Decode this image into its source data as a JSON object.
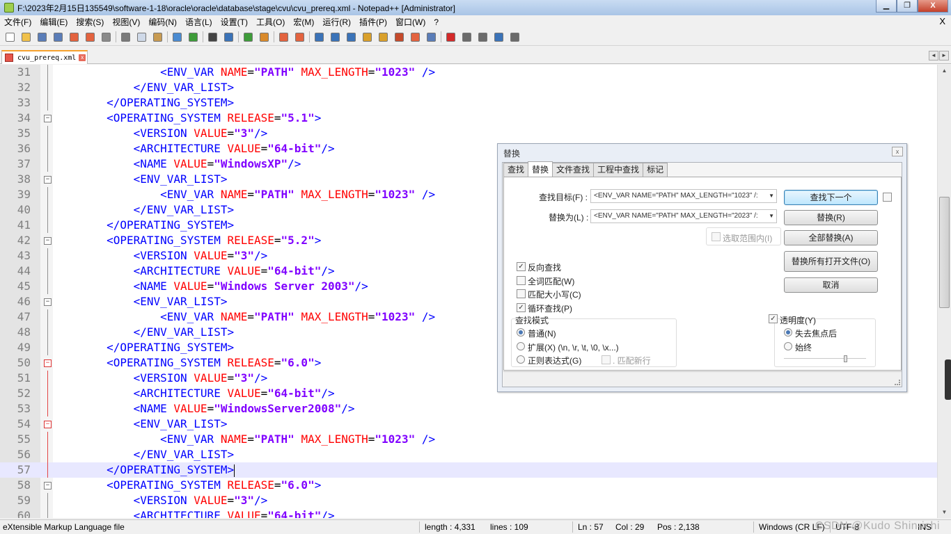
{
  "window": {
    "title": "F:\\2023年2月15日135549\\software-1-18\\oracle\\oracle\\database\\stage\\cvu\\cvu_prereq.xml - Notepad++ [Administrator]",
    "minimize": "▁",
    "maximize": "❐",
    "close": "X"
  },
  "menu": {
    "items": [
      "文件(F)",
      "编辑(E)",
      "搜索(S)",
      "视图(V)",
      "编码(N)",
      "语言(L)",
      "设置(T)",
      "工具(O)",
      "宏(M)",
      "运行(R)",
      "插件(P)",
      "窗口(W)",
      "?"
    ],
    "close": "X"
  },
  "toolbar": {
    "groups": [
      [
        {
          "icon": "new-file-icon",
          "color": "#ffffff"
        },
        {
          "icon": "open-file-icon",
          "color": "#f0c14b"
        },
        {
          "icon": "save-icon",
          "color": "#5a7db8"
        },
        {
          "icon": "save-all-icon",
          "color": "#5a7db8"
        },
        {
          "icon": "close-icon",
          "color": "#e3633f"
        },
        {
          "icon": "close-all-icon",
          "color": "#e3633f"
        },
        {
          "icon": "print-icon",
          "color": "#8a8a8a"
        }
      ],
      [
        {
          "icon": "cut-icon",
          "color": "#7a7a7a"
        },
        {
          "icon": "copy-icon",
          "color": "#cfd9e8"
        },
        {
          "icon": "paste-icon",
          "color": "#c89b52"
        }
      ],
      [
        {
          "icon": "undo-icon",
          "color": "#4b8bd1"
        },
        {
          "icon": "redo-icon",
          "color": "#3e9c3a"
        }
      ],
      [
        {
          "icon": "find-icon",
          "color": "#444444"
        },
        {
          "icon": "replace-icon",
          "color": "#3b73b8"
        }
      ],
      [
        {
          "icon": "zoom-in-icon",
          "color": "#3e9c3a"
        },
        {
          "icon": "zoom-out-icon",
          "color": "#d98a2b"
        }
      ],
      [
        {
          "icon": "sync-vertical-icon",
          "color": "#e3633f"
        },
        {
          "icon": "sync-horizontal-icon",
          "color": "#e3633f"
        }
      ],
      [
        {
          "icon": "word-wrap-icon",
          "color": "#3b73b8"
        },
        {
          "icon": "show-all-chars-icon",
          "color": "#3b73b8"
        },
        {
          "icon": "indent-guide-icon",
          "color": "#3b73b8"
        },
        {
          "icon": "user-lang-icon",
          "color": "#d9a02b"
        },
        {
          "icon": "doc-map-icon",
          "color": "#d9a02b"
        },
        {
          "icon": "function-list-icon",
          "color": "#c54a2b"
        },
        {
          "icon": "folder-workspace-icon",
          "color": "#e3633f"
        },
        {
          "icon": "monitor-icon",
          "color": "#5a7db8"
        }
      ],
      [
        {
          "icon": "record-macro-icon",
          "color": "#d42a2a"
        },
        {
          "icon": "stop-macro-icon",
          "color": "#6b6b6b"
        },
        {
          "icon": "play-macro-icon",
          "color": "#6b6b6b"
        },
        {
          "icon": "run-macro-multiple-icon",
          "color": "#3b73b8"
        },
        {
          "icon": "save-macro-icon",
          "color": "#6b6b6b"
        }
      ]
    ]
  },
  "tabs": {
    "active_label": "cvu_prereq.xml",
    "close": "x",
    "scroll_left": "◄",
    "scroll_right": "►"
  },
  "editor": {
    "lines": [
      {
        "n": "31",
        "fold": "line",
        "tokens": [
          [
            "t",
            "                "
          ],
          [
            "g",
            "<ENV_VAR "
          ],
          [
            "a",
            "NAME"
          ],
          [
            "t",
            "="
          ],
          [
            "v",
            "\"PATH\""
          ],
          [
            "t",
            " "
          ],
          [
            "a",
            "MAX_LENGTH"
          ],
          [
            "t",
            "="
          ],
          [
            "v",
            "\"1023\""
          ],
          [
            "t",
            " "
          ],
          [
            "g",
            "/>"
          ]
        ]
      },
      {
        "n": "32",
        "fold": "line",
        "tokens": [
          [
            "t",
            "            "
          ],
          [
            "g",
            "</ENV_VAR_LIST>"
          ]
        ]
      },
      {
        "n": "33",
        "fold": "line",
        "tokens": [
          [
            "t",
            "        "
          ],
          [
            "g",
            "</OPERATING_SYSTEM>"
          ]
        ]
      },
      {
        "n": "34",
        "fold": "box",
        "tokens": [
          [
            "t",
            "        "
          ],
          [
            "g",
            "<OPERATING_SYSTEM "
          ],
          [
            "a",
            "RELEASE"
          ],
          [
            "t",
            "="
          ],
          [
            "v",
            "\"5.1\""
          ],
          [
            "g",
            ">"
          ]
        ]
      },
      {
        "n": "35",
        "fold": "line",
        "tokens": [
          [
            "t",
            "            "
          ],
          [
            "g",
            "<VERSION "
          ],
          [
            "a",
            "VALUE"
          ],
          [
            "t",
            "="
          ],
          [
            "v",
            "\"3\""
          ],
          [
            "g",
            "/>"
          ]
        ]
      },
      {
        "n": "36",
        "fold": "line",
        "tokens": [
          [
            "t",
            "            "
          ],
          [
            "g",
            "<ARCHITECTURE "
          ],
          [
            "a",
            "VALUE"
          ],
          [
            "t",
            "="
          ],
          [
            "v",
            "\"64-bit\""
          ],
          [
            "g",
            "/>"
          ]
        ]
      },
      {
        "n": "37",
        "fold": "line",
        "tokens": [
          [
            "t",
            "            "
          ],
          [
            "g",
            "<NAME "
          ],
          [
            "a",
            "VALUE"
          ],
          [
            "t",
            "="
          ],
          [
            "v",
            "\"WindowsXP\""
          ],
          [
            "g",
            "/>"
          ]
        ]
      },
      {
        "n": "38",
        "fold": "box",
        "tokens": [
          [
            "t",
            "            "
          ],
          [
            "g",
            "<ENV_VAR_LIST>"
          ]
        ]
      },
      {
        "n": "39",
        "fold": "line",
        "tokens": [
          [
            "t",
            "                "
          ],
          [
            "g",
            "<ENV_VAR "
          ],
          [
            "a",
            "NAME"
          ],
          [
            "t",
            "="
          ],
          [
            "v",
            "\"PATH\""
          ],
          [
            "t",
            " "
          ],
          [
            "a",
            "MAX_LENGTH"
          ],
          [
            "t",
            "="
          ],
          [
            "v",
            "\"1023\""
          ],
          [
            "t",
            " "
          ],
          [
            "g",
            "/>"
          ]
        ]
      },
      {
        "n": "40",
        "fold": "line",
        "tokens": [
          [
            "t",
            "            "
          ],
          [
            "g",
            "</ENV_VAR_LIST>"
          ]
        ]
      },
      {
        "n": "41",
        "fold": "line",
        "tokens": [
          [
            "t",
            "        "
          ],
          [
            "g",
            "</OPERATING_SYSTEM>"
          ]
        ]
      },
      {
        "n": "42",
        "fold": "box",
        "tokens": [
          [
            "t",
            "        "
          ],
          [
            "g",
            "<OPERATING_SYSTEM "
          ],
          [
            "a",
            "RELEASE"
          ],
          [
            "t",
            "="
          ],
          [
            "v",
            "\"5.2\""
          ],
          [
            "g",
            ">"
          ]
        ]
      },
      {
        "n": "43",
        "fold": "line",
        "tokens": [
          [
            "t",
            "            "
          ],
          [
            "g",
            "<VERSION "
          ],
          [
            "a",
            "VALUE"
          ],
          [
            "t",
            "="
          ],
          [
            "v",
            "\"3\""
          ],
          [
            "g",
            "/>"
          ]
        ]
      },
      {
        "n": "44",
        "fold": "line",
        "tokens": [
          [
            "t",
            "            "
          ],
          [
            "g",
            "<ARCHITECTURE "
          ],
          [
            "a",
            "VALUE"
          ],
          [
            "t",
            "="
          ],
          [
            "v",
            "\"64-bit\""
          ],
          [
            "g",
            "/>"
          ]
        ]
      },
      {
        "n": "45",
        "fold": "line",
        "tokens": [
          [
            "t",
            "            "
          ],
          [
            "g",
            "<NAME "
          ],
          [
            "a",
            "VALUE"
          ],
          [
            "t",
            "="
          ],
          [
            "v",
            "\"Windows Server 2003\""
          ],
          [
            "g",
            "/>"
          ]
        ]
      },
      {
        "n": "46",
        "fold": "box",
        "tokens": [
          [
            "t",
            "            "
          ],
          [
            "g",
            "<ENV_VAR_LIST>"
          ]
        ]
      },
      {
        "n": "47",
        "fold": "line",
        "tokens": [
          [
            "t",
            "                "
          ],
          [
            "g",
            "<ENV_VAR "
          ],
          [
            "a",
            "NAME"
          ],
          [
            "t",
            "="
          ],
          [
            "v",
            "\"PATH\""
          ],
          [
            "t",
            " "
          ],
          [
            "a",
            "MAX_LENGTH"
          ],
          [
            "t",
            "="
          ],
          [
            "v",
            "\"1023\""
          ],
          [
            "t",
            " "
          ],
          [
            "g",
            "/>"
          ]
        ]
      },
      {
        "n": "48",
        "fold": "line",
        "tokens": [
          [
            "t",
            "            "
          ],
          [
            "g",
            "</ENV_VAR_LIST>"
          ]
        ]
      },
      {
        "n": "49",
        "fold": "line",
        "tokens": [
          [
            "t",
            "        "
          ],
          [
            "g",
            "</OPERATING_SYSTEM>"
          ]
        ]
      },
      {
        "n": "50",
        "fold": "box-red",
        "tokens": [
          [
            "t",
            "        "
          ],
          [
            "g",
            "<OPERATING_SYSTEM "
          ],
          [
            "a",
            "RELEASE"
          ],
          [
            "t",
            "="
          ],
          [
            "v",
            "\"6.0\""
          ],
          [
            "g",
            ">"
          ]
        ]
      },
      {
        "n": "51",
        "fold": "line-red",
        "tokens": [
          [
            "t",
            "            "
          ],
          [
            "g",
            "<VERSION "
          ],
          [
            "a",
            "VALUE"
          ],
          [
            "t",
            "="
          ],
          [
            "v",
            "\"3\""
          ],
          [
            "g",
            "/>"
          ]
        ]
      },
      {
        "n": "52",
        "fold": "line-red",
        "tokens": [
          [
            "t",
            "            "
          ],
          [
            "g",
            "<ARCHITECTURE "
          ],
          [
            "a",
            "VALUE"
          ],
          [
            "t",
            "="
          ],
          [
            "v",
            "\"64-bit\""
          ],
          [
            "g",
            "/>"
          ]
        ]
      },
      {
        "n": "53",
        "fold": "line-red",
        "tokens": [
          [
            "t",
            "            "
          ],
          [
            "g",
            "<NAME "
          ],
          [
            "a",
            "VALUE"
          ],
          [
            "t",
            "="
          ],
          [
            "v",
            "\"WindowsServer2008\""
          ],
          [
            "g",
            "/>"
          ]
        ]
      },
      {
        "n": "54",
        "fold": "box-red",
        "tokens": [
          [
            "t",
            "            "
          ],
          [
            "g",
            "<ENV_VAR_LIST>"
          ]
        ]
      },
      {
        "n": "55",
        "fold": "line-red",
        "tokens": [
          [
            "t",
            "                "
          ],
          [
            "g",
            "<ENV_VAR "
          ],
          [
            "a",
            "NAME"
          ],
          [
            "t",
            "="
          ],
          [
            "v",
            "\"PATH\""
          ],
          [
            "t",
            " "
          ],
          [
            "a",
            "MAX_LENGTH"
          ],
          [
            "t",
            "="
          ],
          [
            "v",
            "\"1023\""
          ],
          [
            "t",
            " "
          ],
          [
            "g",
            "/>"
          ]
        ]
      },
      {
        "n": "56",
        "fold": "line-red",
        "tokens": [
          [
            "t",
            "            "
          ],
          [
            "g",
            "</ENV_VAR_LIST>"
          ]
        ]
      },
      {
        "n": "57",
        "fold": "line-red",
        "current": true,
        "tokens": [
          [
            "t",
            "        "
          ],
          [
            "g",
            "</OPERATING_SYSTEM>"
          ]
        ]
      },
      {
        "n": "58",
        "fold": "box",
        "tokens": [
          [
            "t",
            "        "
          ],
          [
            "g",
            "<OPERATING_SYSTEM "
          ],
          [
            "a",
            "RELEASE"
          ],
          [
            "t",
            "="
          ],
          [
            "v",
            "\"6.0\""
          ],
          [
            "g",
            ">"
          ]
        ]
      },
      {
        "n": "59",
        "fold": "line",
        "tokens": [
          [
            "t",
            "            "
          ],
          [
            "g",
            "<VERSION "
          ],
          [
            "a",
            "VALUE"
          ],
          [
            "t",
            "="
          ],
          [
            "v",
            "\"3\""
          ],
          [
            "g",
            "/>"
          ]
        ]
      },
      {
        "n": "60",
        "fold": "line",
        "tokens": [
          [
            "t",
            "            "
          ],
          [
            "g",
            "<ARCHITECTURE "
          ],
          [
            "a",
            "VALUE"
          ],
          [
            "t",
            "="
          ],
          [
            "v",
            "\"64-bit\""
          ],
          [
            "g",
            "/>"
          ]
        ]
      }
    ],
    "colors": {
      "tag": "#0000ff",
      "attribute": "#ff0000",
      "value": "#8000ff",
      "current_line": "#e8e8ff"
    }
  },
  "scrollbar": {
    "up": "▲",
    "down": "▼"
  },
  "statusbar": {
    "file_type": "eXtensible Markup Language file",
    "length": "length : 4,331",
    "lines": "lines : 109",
    "ln": "Ln : 57",
    "col": "Col : 29",
    "pos": "Pos : 2,138",
    "eol": "Windows (CR LF)",
    "encoding": "UTF-8",
    "mode": "INS",
    "watermark": "CSDN @Kudo Shin-ichi"
  },
  "dialog": {
    "title": "替换",
    "close": "x",
    "tabs": [
      "查找",
      "替换",
      "文件查找",
      "工程中查找",
      "标记"
    ],
    "active_tab": 1,
    "find_label": "查找目标(F) :",
    "find_value": "<ENV_VAR NAME=\"PATH\" MAX_LENGTH=\"1023\" /:",
    "replace_label": "替换为(L) :",
    "replace_value": "<ENV_VAR NAME=\"PATH\" MAX_LENGTH=\"2023\" /:",
    "combo_arrow": "▼",
    "in_selection": "选取范围内(I)",
    "buttons": {
      "find_next": "查找下一个",
      "replace": "替换(R)",
      "replace_all": "全部替换(A)",
      "replace_all_open": "替换所有打开文件(O)",
      "cancel": "取消"
    },
    "options": [
      {
        "label": "反向查找",
        "checked": true
      },
      {
        "label": "全词匹配(W)",
        "checked": false
      },
      {
        "label": "匹配大小写(C)",
        "checked": false
      },
      {
        "label": "循环查找(P)",
        "checked": true
      }
    ],
    "search_mode": {
      "title": "查找模式",
      "normal": "普通(N)",
      "extended": "扩展(X) (\\n, \\r, \\t, \\0, \\x...)",
      "regex": "正则表达式(G)",
      "dot_newline": ". 匹配新行",
      "selected": "normal"
    },
    "transparency": {
      "label": "透明度(Y)",
      "checked": true,
      "on_lose_focus": "失去焦点后",
      "always": "始终",
      "selected": "on_lose_focus",
      "level": 0.75
    },
    "check_mark": "✓"
  }
}
